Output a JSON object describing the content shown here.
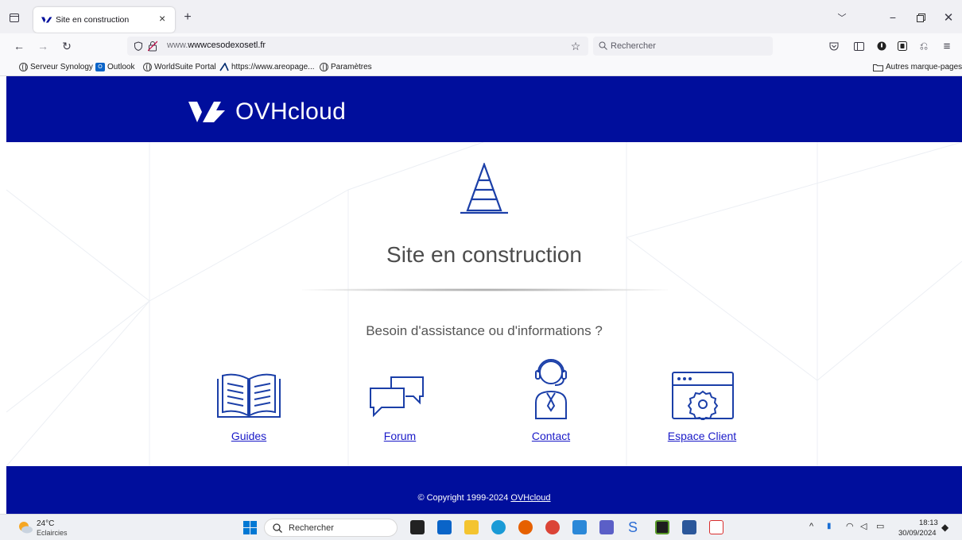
{
  "browser": {
    "tab_title": "Site en construction",
    "url_prefix": "www.",
    "url_domain": "wwwcesodexosetl.fr",
    "search_placeholder": "Rechercher",
    "bookmarks": [
      "Serveur Synology",
      "Outlook",
      "WorldSuite Portal",
      "https://www.areopage...",
      "Paramètres"
    ],
    "other_bookmarks": "Autres marque-pages"
  },
  "page": {
    "brand": "OVHcloud",
    "heading": "Site en construction",
    "subheading": "Besoin d'assistance ou d'informations ?",
    "services": [
      {
        "label": "Guides",
        "icon": "book-icon"
      },
      {
        "label": "Forum",
        "icon": "chat-bubbles-icon"
      },
      {
        "label": "Contact",
        "icon": "support-agent-icon"
      },
      {
        "label": "Espace Client",
        "icon": "settings-window-icon"
      }
    ],
    "copyright": "© Copyright 1999-2024",
    "copyright_link": "OVHcloud",
    "colors": {
      "brand_blue": "#000e9c",
      "line_blue": "#1b3fa8",
      "link_blue": "#1a1ac8"
    }
  },
  "taskbar": {
    "weather_temp": "24°C",
    "weather_desc": "Eclaircies",
    "search_placeholder": "Rechercher",
    "time": "18:13",
    "date": "30/09/2024"
  }
}
